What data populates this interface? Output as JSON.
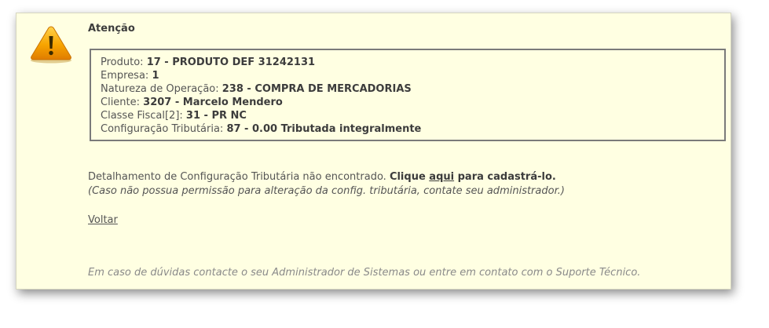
{
  "dialog": {
    "title": "Atenção",
    "icon": "warning-icon",
    "details": [
      {
        "label": "Produto: ",
        "value": "17 - PRODUTO DEF 31242131"
      },
      {
        "label": "Empresa: ",
        "value": "1"
      },
      {
        "label": "Natureza de Operação: ",
        "value": "238 - COMPRA DE MERCADORIAS"
      },
      {
        "label": "Cliente: ",
        "value": "3207 - Marcelo Mendero"
      },
      {
        "label": "Classe Fiscal[2]: ",
        "value": "31 - PR NC"
      },
      {
        "label": "Configuração Tributária: ",
        "value": "87 - 0.00 Tributada integralmente"
      }
    ],
    "message": {
      "text": "Detalhamento de Configuração Tributária não encontrado. ",
      "click": "Clique ",
      "link": "aqui",
      "after": " para cadastrá-lo."
    },
    "hint": "(Caso não possua permissão para alteração da config. tributária, contate seu administrador.)",
    "back_label": "Voltar",
    "footer": "Em caso de dúvidas contacte o seu Administrador de Sistemas ou entre em contato com o Suporte Técnico."
  },
  "colors": {
    "panel_bg": "#ffffe2",
    "icon_orange": "#f29a00"
  }
}
